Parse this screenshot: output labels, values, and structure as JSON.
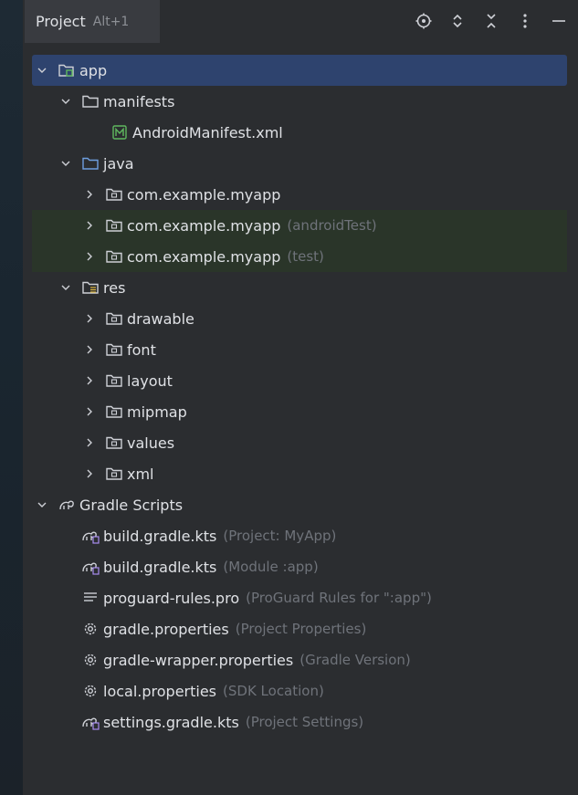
{
  "header": {
    "tab_label": "Project",
    "tab_shortcut": "Alt+1"
  },
  "toolbar": {
    "icons": [
      "locate-icon",
      "expand-icon",
      "collapse-icon",
      "more-icon",
      "minimize-icon"
    ]
  },
  "tree": {
    "app": {
      "label": "app"
    },
    "manifests": {
      "label": "manifests"
    },
    "android_manifest": {
      "label": "AndroidManifest.xml"
    },
    "java": {
      "label": "java"
    },
    "pkg_main": {
      "label": "com.example.myapp",
      "hint": ""
    },
    "pkg_android_test": {
      "label": "com.example.myapp",
      "hint": "(androidTest)"
    },
    "pkg_test": {
      "label": "com.example.myapp",
      "hint": "(test)"
    },
    "res": {
      "label": "res"
    },
    "drawable": {
      "label": "drawable"
    },
    "font": {
      "label": "font"
    },
    "layout": {
      "label": "layout"
    },
    "mipmap": {
      "label": "mipmap"
    },
    "values": {
      "label": "values"
    },
    "xml": {
      "label": "xml"
    },
    "gradle_scripts": {
      "label": "Gradle Scripts"
    },
    "build_project": {
      "label": "build.gradle.kts",
      "hint": "(Project: MyApp)"
    },
    "build_module": {
      "label": "build.gradle.kts",
      "hint": "(Module :app)"
    },
    "proguard": {
      "label": "proguard-rules.pro",
      "hint": "(ProGuard Rules for \":app\")"
    },
    "gradle_props": {
      "label": "gradle.properties",
      "hint": "(Project Properties)"
    },
    "wrapper_props": {
      "label": "gradle-wrapper.properties",
      "hint": "(Gradle Version)"
    },
    "local_props": {
      "label": "local.properties",
      "hint": "(SDK Location)"
    },
    "settings": {
      "label": "settings.gradle.kts",
      "hint": "(Project Settings)"
    }
  },
  "colors": {
    "panel_bg": "#2b2d30",
    "selection": "#2e436e",
    "test_bg": "#2a3529",
    "hint": "#6f737a",
    "text": "#dfe1e5",
    "manifest_icon": "#5fb85f"
  }
}
